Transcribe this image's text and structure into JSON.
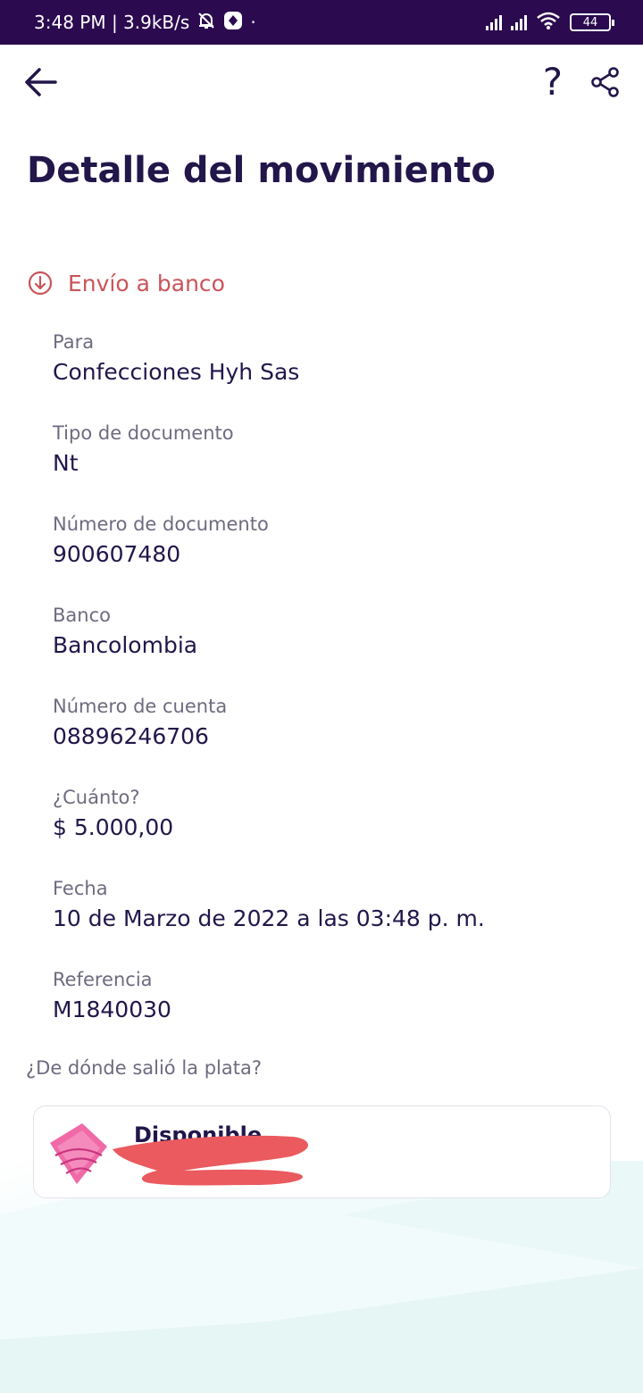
{
  "status_bar": {
    "time_speed": "3:48 PM | 3.9kB/s",
    "battery": "44"
  },
  "header": {
    "back_icon": "arrow-left-icon",
    "help_label": "?",
    "share_icon": "share-icon"
  },
  "title": "Detalle del movimiento",
  "movement_type": {
    "label": "Envío a banco",
    "icon": "arrow-down-circle-icon",
    "color": "#c9545a"
  },
  "fields": [
    {
      "label": "Para",
      "value": "Confecciones Hyh Sas"
    },
    {
      "label": "Tipo de documento",
      "value": "Nt"
    },
    {
      "label": "Número de documento",
      "value": "900607480"
    },
    {
      "label": "Banco",
      "value": "Bancolombia"
    },
    {
      "label": "Número de cuenta",
      "value": "08896246706"
    },
    {
      "label": "¿Cuánto?",
      "value": "$ 5.000,00"
    },
    {
      "label": "Fecha",
      "value": "10 de Marzo de 2022 a las 03:48 p. m."
    },
    {
      "label": "Referencia",
      "value": "M1840030"
    }
  ],
  "source": {
    "question": "¿De dónde salió la plata?",
    "pocket_label": "Disponible"
  },
  "colors": {
    "primary_dark": "#22164a",
    "status_bar": "#2b0a4f",
    "accent_red": "#c9545a"
  }
}
